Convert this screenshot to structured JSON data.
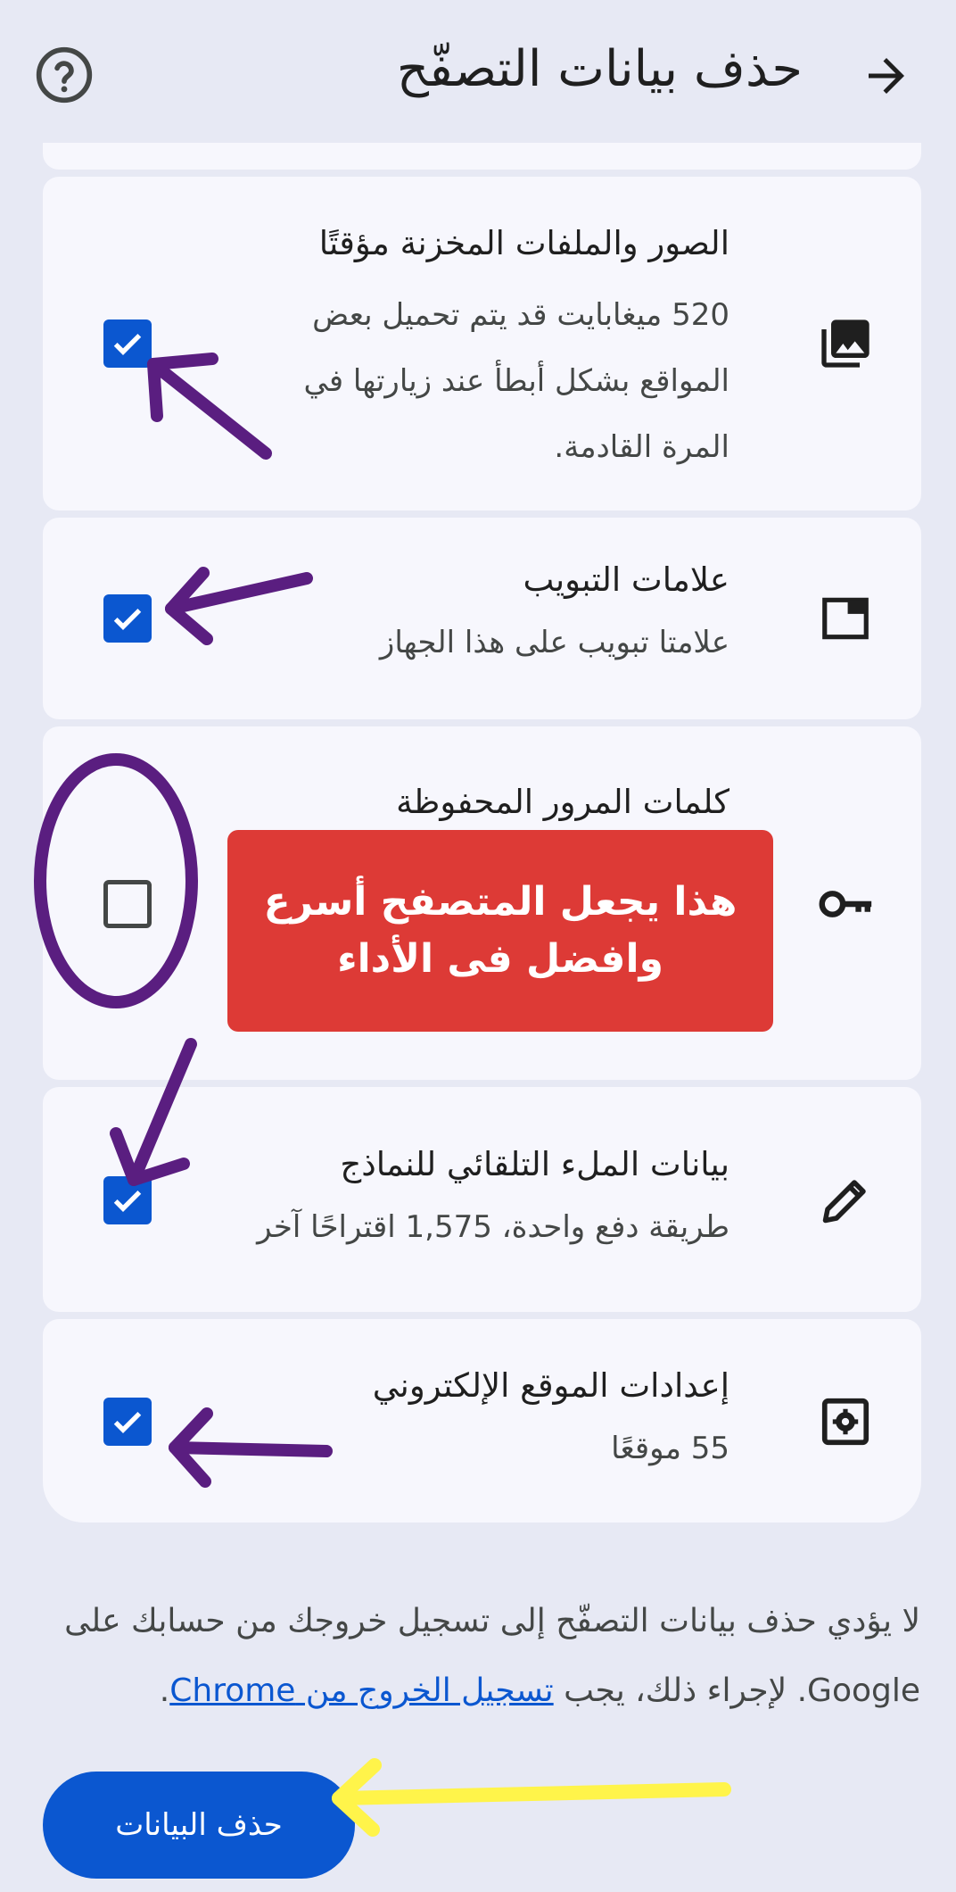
{
  "header": {
    "title": "حذف بيانات التصفّح",
    "back_icon": "arrow-right-icon",
    "help_icon": "help-circle-icon"
  },
  "rows": [
    {
      "title": "الصور والملفات المخزنة مؤقتًا",
      "description": "520 ميغابايت قد يتم تحميل بعض المواقع بشكل أبطأ عند زيارتها في المرة القادمة.",
      "icon": "images-icon",
      "checked": true
    },
    {
      "title": "علامات التبويب",
      "description": "علامتا تبويب على هذا الجهاز",
      "icon": "tab-icon",
      "checked": true
    },
    {
      "title": "كلمات المرور المحفوظة",
      "description": "",
      "icon": "key-icon",
      "checked": false
    },
    {
      "title": "بيانات الملء التلقائي للنماذج",
      "description": "طريقة دفع واحدة، 1,575 اقتراحًا آخر",
      "icon": "pencil-icon",
      "checked": true
    },
    {
      "title": "إعدادات الموقع الإلكتروني",
      "description": "55 موقعًا",
      "icon": "site-settings-icon",
      "checked": true
    }
  ],
  "footer": {
    "text_before": "لا يؤدي حذف بيانات التصفّح إلى تسجيل خروجك من حسابك على Google. لإجراء ذلك، يجب ",
    "link_text": "تسجيل الخروج من Chrome",
    "text_after": "."
  },
  "delete_button": {
    "label": "حذف البيانات"
  },
  "annotation": {
    "line1": "هذا يجعل المتصفح أسرع",
    "line2": "وافضل فى الأداء"
  },
  "colors": {
    "accent": "#0b57d0",
    "background": "#e7e9f4",
    "card": "#f7f7fd",
    "callout": "#dd3a36",
    "annotation_purple": "#5a1e80",
    "annotation_yellow": "#fff44a"
  }
}
